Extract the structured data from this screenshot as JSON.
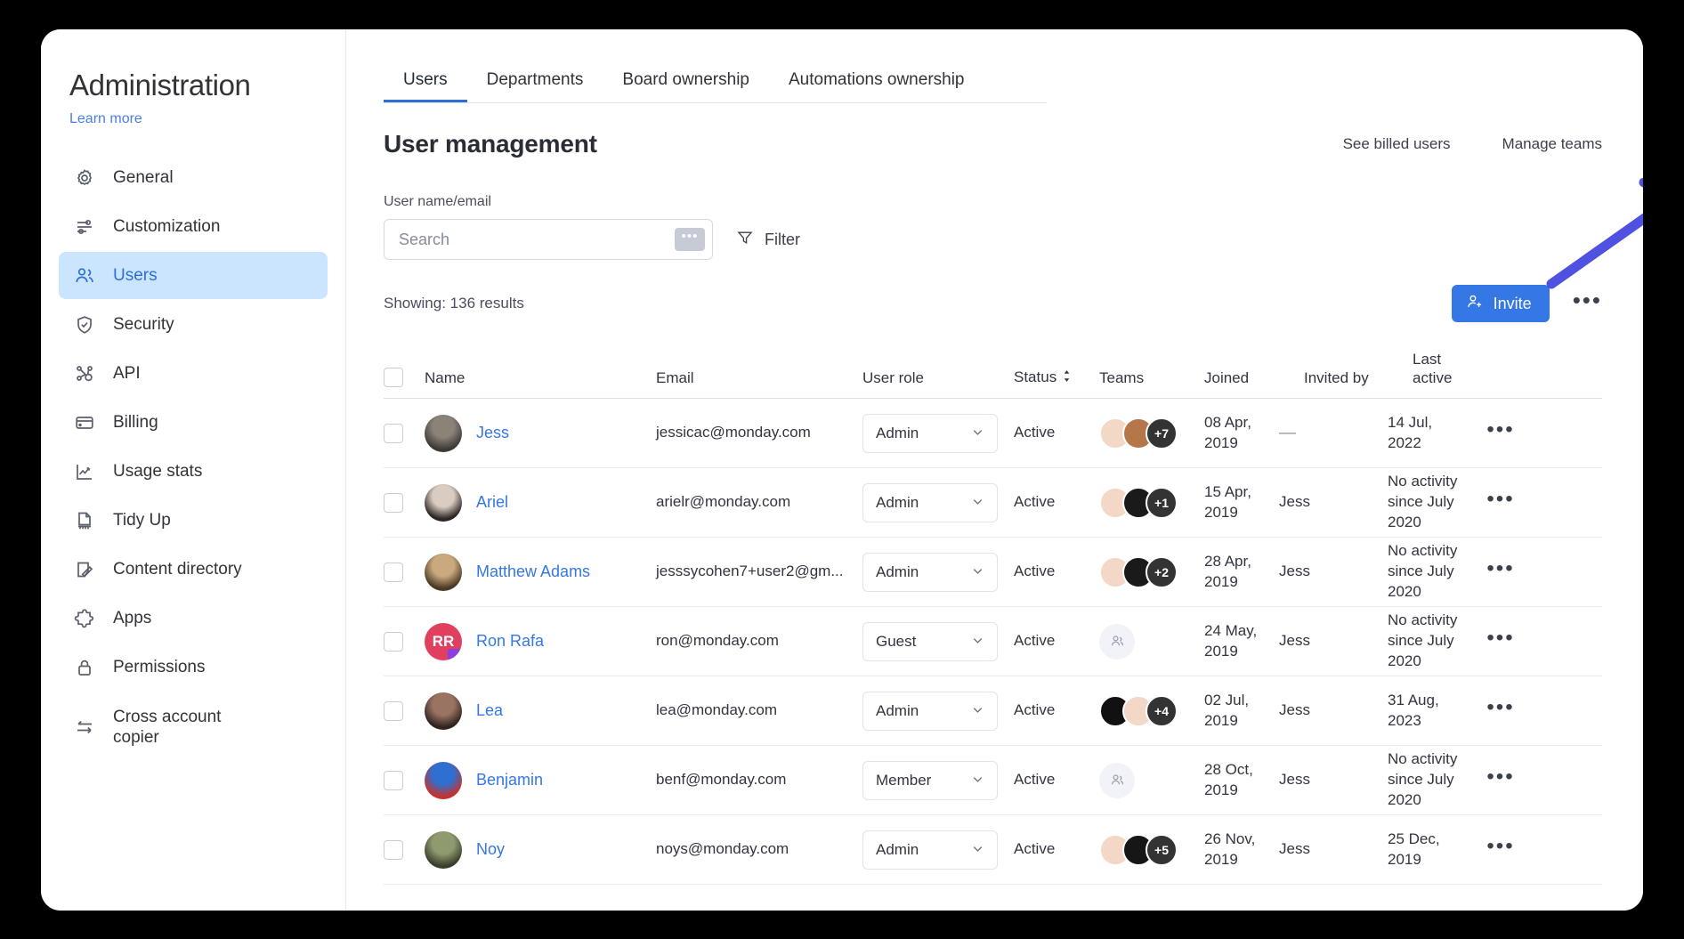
{
  "sidebar": {
    "title": "Administration",
    "learn_more": "Learn more",
    "items": [
      {
        "label": "General",
        "icon": "gear-icon"
      },
      {
        "label": "Customization",
        "icon": "sliders-icon"
      },
      {
        "label": "Users",
        "icon": "users-icon",
        "active": true
      },
      {
        "label": "Security",
        "icon": "shield-check-icon"
      },
      {
        "label": "API",
        "icon": "api-nodes-icon"
      },
      {
        "label": "Billing",
        "icon": "credit-card-icon"
      },
      {
        "label": "Usage stats",
        "icon": "chart-line-icon"
      },
      {
        "label": "Tidy Up",
        "icon": "tidy-up-icon"
      },
      {
        "label": "Content directory",
        "icon": "content-directory-icon"
      },
      {
        "label": "Apps",
        "icon": "puzzle-icon"
      },
      {
        "label": "Permissions",
        "icon": "lock-icon"
      },
      {
        "label": "Cross account copier",
        "icon": "arrows-exchange-icon"
      }
    ]
  },
  "tabs": [
    {
      "label": "Users",
      "active": true
    },
    {
      "label": "Departments",
      "active": false
    },
    {
      "label": "Board ownership",
      "active": false
    },
    {
      "label": "Automations ownership",
      "active": false
    }
  ],
  "header": {
    "page_title": "User management",
    "links": [
      "See billed users",
      "Manage teams"
    ]
  },
  "search": {
    "label": "User name/email",
    "placeholder": "Search",
    "value": "",
    "hint": "•••",
    "filter_label": "Filter"
  },
  "results": {
    "count_text": "Showing: 136 results",
    "invite_label": "Invite",
    "more_label": "•••"
  },
  "table": {
    "columns": [
      {
        "key": "name",
        "label": "Name"
      },
      {
        "key": "email",
        "label": "Email"
      },
      {
        "key": "role",
        "label": "User role"
      },
      {
        "key": "status",
        "label": "Status",
        "sortable": true
      },
      {
        "key": "teams",
        "label": "Teams"
      },
      {
        "key": "joined",
        "label": "Joined"
      },
      {
        "key": "invited_by",
        "label": "Invited by"
      },
      {
        "key": "last_active",
        "label": "Last active"
      }
    ],
    "rows": [
      {
        "name": "Jess",
        "email": "jessicac@monday.com",
        "role": "Admin",
        "status": "Active",
        "teams_extra": "+7",
        "teams_colors": [
          "#f3d7c7",
          "#b5774a"
        ],
        "avatar_colors": [
          "#8b8278",
          "#3d3a36"
        ],
        "joined": "08 Apr, 2019",
        "invited_by": "—",
        "last_active": "14 Jul, 2022"
      },
      {
        "name": "Ariel",
        "email": "arielr@monday.com",
        "role": "Admin",
        "status": "Active",
        "teams_extra": "+1",
        "teams_colors": [
          "#f3d7c7",
          "#1a1a1a"
        ],
        "avatar_colors": [
          "#d9ccc2",
          "#2b2622"
        ],
        "joined": "15 Apr, 2019",
        "invited_by": "Jess",
        "last_active": "No activity since July 2020"
      },
      {
        "name": "Matthew Adams",
        "email": "jesssycohen7+user2@gm...",
        "role": "Admin",
        "status": "Active",
        "teams_extra": "+2",
        "teams_colors": [
          "#f3d7c7",
          "#1a1a1a"
        ],
        "avatar_colors": [
          "#caa97f",
          "#4a3a24"
        ],
        "joined": "28 Apr, 2019",
        "invited_by": "Jess",
        "last_active": "No activity since July 2020"
      },
      {
        "name": "Ron Rafa",
        "email": "ron@monday.com",
        "role": "Guest",
        "status": "Active",
        "teams_extra": "",
        "teams_colors": [],
        "avatar_initials": "RR",
        "avatar_bg": "#e0405e",
        "guest_badge": true,
        "joined": "24 May, 2019",
        "invited_by": "Jess",
        "last_active": "No activity since July 2020"
      },
      {
        "name": "Lea",
        "email": "lea@monday.com",
        "role": "Admin",
        "status": "Active",
        "teams_extra": "+4",
        "teams_colors": [
          "#111111",
          "#f3d7c7"
        ],
        "avatar_colors": [
          "#9b7363",
          "#2f2320"
        ],
        "joined": "02 Jul, 2019",
        "invited_by": "Jess",
        "last_active": "31 Aug, 2023"
      },
      {
        "name": "Benjamin",
        "email": "benf@monday.com",
        "role": "Member",
        "status": "Active",
        "teams_extra": "",
        "teams_colors": [],
        "avatar_colors": [
          "#2f6fd0",
          "#c3342f"
        ],
        "joined": "28 Oct, 2019",
        "invited_by": "Jess",
        "last_active": "No activity since July 2020"
      },
      {
        "name": "Noy",
        "email": "noys@monday.com",
        "role": "Admin",
        "status": "Active",
        "teams_extra": "+5",
        "teams_colors": [
          "#f3d7c7",
          "#161616"
        ],
        "avatar_colors": [
          "#8f9b6f",
          "#3a3f2c"
        ],
        "joined": "26 Nov, 2019",
        "invited_by": "Jess",
        "last_active": "25 Dec, 2019"
      }
    ]
  },
  "annotation": {
    "arrow_color": "#4f51e0",
    "points_to": "See billed users"
  },
  "colors": {
    "accent": "#3577e5",
    "sidebar_active_bg": "#cce5ff",
    "link": "#3577e5",
    "text": "#323338"
  }
}
